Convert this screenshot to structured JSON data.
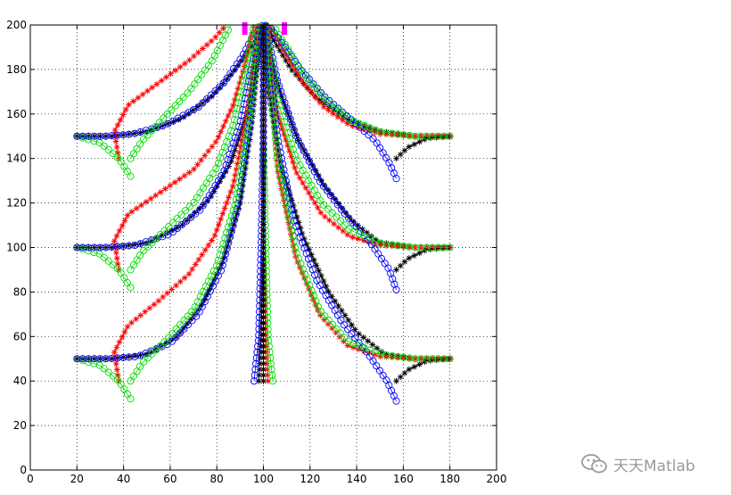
{
  "chart_data": {
    "type": "line",
    "title": "",
    "xlabel": "",
    "ylabel": "",
    "xlim": [
      0,
      200
    ],
    "ylim": [
      0,
      200
    ],
    "xticks": [
      0,
      20,
      40,
      60,
      80,
      100,
      120,
      140,
      160,
      180,
      200
    ],
    "yticks": [
      0,
      20,
      40,
      60,
      80,
      100,
      120,
      140,
      160,
      180,
      200
    ],
    "grid": "dotted",
    "legend": "none",
    "series_colors": {
      "red": "#ff0000",
      "green": "#00dd00",
      "blue": "#0000ff",
      "black": "#000000",
      "magenta": "#ff00ff"
    },
    "series": [
      {
        "color": "black",
        "marker": "star",
        "x": [
          20,
          35,
          50,
          65,
          78,
          88,
          96,
          100
        ],
        "y": [
          150,
          150,
          152,
          158,
          168,
          180,
          192,
          200
        ]
      },
      {
        "color": "red",
        "marker": "star",
        "x": [
          38,
          36,
          42,
          55,
          68,
          79,
          84
        ],
        "y": [
          140,
          152,
          164,
          174,
          184,
          194,
          200
        ]
      },
      {
        "color": "green",
        "marker": "circle",
        "x": [
          43,
          38,
          30,
          20
        ],
        "y": [
          132,
          140,
          147,
          150
        ]
      },
      {
        "color": "blue",
        "marker": "circle",
        "x": [
          20,
          32,
          44,
          58,
          72,
          83,
          91,
          96,
          100
        ],
        "y": [
          150,
          150,
          151,
          155,
          163,
          174,
          186,
          196,
          200
        ]
      },
      {
        "color": "green",
        "marker": "circle",
        "x": [
          43,
          48,
          57,
          68,
          78,
          86
        ],
        "y": [
          140,
          148,
          158,
          170,
          184,
          200
        ]
      },
      {
        "color": "black",
        "marker": "star",
        "x": [
          20,
          35,
          50,
          65,
          77,
          86,
          93,
          98,
          100
        ],
        "y": [
          100,
          100,
          102,
          110,
          122,
          138,
          160,
          185,
          200
        ]
      },
      {
        "color": "red",
        "marker": "star",
        "x": [
          38,
          36,
          42,
          56,
          70,
          80,
          87,
          92,
          96
        ],
        "y": [
          90,
          103,
          115,
          125,
          135,
          148,
          164,
          182,
          200
        ]
      },
      {
        "color": "green",
        "marker": "circle",
        "x": [
          43,
          38,
          30,
          20
        ],
        "y": [
          82,
          90,
          97,
          100
        ]
      },
      {
        "color": "blue",
        "marker": "circle",
        "x": [
          20,
          32,
          45,
          60,
          73,
          83,
          90,
          95,
          99
        ],
        "y": [
          100,
          100,
          101,
          106,
          117,
          134,
          156,
          182,
          200
        ]
      },
      {
        "color": "green",
        "marker": "circle",
        "x": [
          43,
          48,
          58,
          70,
          80,
          87,
          92,
          96
        ],
        "y": [
          90,
          98,
          108,
          120,
          136,
          155,
          177,
          200
        ]
      },
      {
        "color": "black",
        "marker": "star",
        "x": [
          20,
          35,
          50,
          63,
          74,
          83,
          90,
          95,
          99
        ],
        "y": [
          50,
          50,
          52,
          60,
          75,
          95,
          120,
          155,
          200
        ]
      },
      {
        "color": "red",
        "marker": "star",
        "x": [
          38,
          36,
          42,
          55,
          68,
          79,
          87,
          93,
          98
        ],
        "y": [
          40,
          53,
          65,
          76,
          88,
          105,
          128,
          160,
          200
        ]
      },
      {
        "color": "green",
        "marker": "circle",
        "x": [
          43,
          38,
          30,
          20
        ],
        "y": [
          32,
          40,
          47,
          50
        ]
      },
      {
        "color": "blue",
        "marker": "circle",
        "x": [
          20,
          33,
          46,
          60,
          72,
          82,
          89,
          94,
          98
        ],
        "y": [
          50,
          50,
          51,
          57,
          70,
          90,
          118,
          155,
          200
        ]
      },
      {
        "color": "green",
        "marker": "circle",
        "x": [
          43,
          48,
          58,
          70,
          80,
          88,
          94,
          98
        ],
        "y": [
          40,
          48,
          58,
          72,
          92,
          120,
          158,
          200
        ]
      },
      {
        "color": "black",
        "marker": "star",
        "x": [
          180,
          165,
          150,
          135,
          122,
          112,
          105,
          101
        ],
        "y": [
          150,
          150,
          152,
          158,
          168,
          180,
          192,
          200
        ]
      },
      {
        "color": "red",
        "marker": "star",
        "x": [
          180,
          165,
          150,
          137,
          126,
          117,
          109,
          103
        ],
        "y": [
          150,
          150,
          151,
          155,
          163,
          174,
          188,
          200
        ]
      },
      {
        "color": "blue",
        "marker": "circle",
        "x": [
          157,
          154,
          148,
          137,
          126,
          116,
          108,
          102
        ],
        "y": [
          131,
          138,
          148,
          158,
          168,
          180,
          192,
          200
        ]
      },
      {
        "color": "black",
        "marker": "star",
        "x": [
          157,
          162,
          170,
          180
        ],
        "y": [
          140,
          145,
          149,
          150
        ]
      },
      {
        "color": "green",
        "marker": "circle",
        "x": [
          180,
          165,
          150,
          138,
          127,
          117,
          110,
          104
        ],
        "y": [
          150,
          150,
          152,
          157,
          166,
          178,
          190,
          200
        ]
      },
      {
        "color": "black",
        "marker": "star",
        "x": [
          180,
          165,
          150,
          138,
          126,
          115,
          107,
          102,
          100
        ],
        "y": [
          100,
          100,
          102,
          112,
          128,
          148,
          170,
          190,
          200
        ]
      },
      {
        "color": "red",
        "marker": "star",
        "x": [
          180,
          165,
          150,
          137,
          125,
          114,
          106,
          101
        ],
        "y": [
          100,
          100,
          101,
          105,
          115,
          134,
          160,
          200
        ]
      },
      {
        "color": "blue",
        "marker": "circle",
        "x": [
          157,
          154,
          146,
          135,
          124,
          114,
          106,
          101
        ],
        "y": [
          81,
          90,
          102,
          115,
          130,
          150,
          175,
          200
        ]
      },
      {
        "color": "black",
        "marker": "star",
        "x": [
          157,
          162,
          170,
          180
        ],
        "y": [
          90,
          95,
          99,
          100
        ]
      },
      {
        "color": "green",
        "marker": "circle",
        "x": [
          180,
          165,
          150,
          137,
          125,
          114,
          106,
          101
        ],
        "y": [
          100,
          100,
          102,
          108,
          120,
          140,
          166,
          200
        ]
      },
      {
        "color": "black",
        "marker": "star",
        "x": [
          180,
          165,
          152,
          140,
          128,
          117,
          108,
          102,
          100
        ],
        "y": [
          50,
          50,
          52,
          62,
          80,
          105,
          135,
          170,
          200
        ]
      },
      {
        "color": "red",
        "marker": "star",
        "x": [
          180,
          165,
          150,
          136,
          124,
          114,
          106,
          102
        ],
        "y": [
          50,
          50,
          51,
          56,
          70,
          95,
          135,
          200
        ]
      },
      {
        "color": "blue",
        "marker": "circle",
        "x": [
          157,
          153,
          145,
          134,
          123,
          113,
          106,
          101
        ],
        "y": [
          31,
          40,
          52,
          66,
          85,
          112,
          150,
          200
        ]
      },
      {
        "color": "black",
        "marker": "star",
        "x": [
          157,
          162,
          170,
          180
        ],
        "y": [
          40,
          45,
          49,
          50
        ]
      },
      {
        "color": "green",
        "marker": "circle",
        "x": [
          180,
          165,
          150,
          136,
          124,
          114,
          106,
          101
        ],
        "y": [
          50,
          50,
          52,
          58,
          72,
          98,
          140,
          200
        ]
      },
      {
        "color": "red",
        "marker": "star",
        "x": [
          102,
          101,
          100,
          100,
          100
        ],
        "y": [
          40,
          60,
          100,
          150,
          200
        ]
      },
      {
        "color": "black",
        "marker": "star",
        "x": [
          98,
          99,
          100,
          100,
          100
        ],
        "y": [
          40,
          60,
          100,
          150,
          200
        ]
      },
      {
        "color": "green",
        "marker": "circle",
        "x": [
          104,
          102,
          101,
          100,
          100
        ],
        "y": [
          40,
          60,
          100,
          150,
          200
        ]
      },
      {
        "color": "blue",
        "marker": "circle",
        "x": [
          96,
          98,
          99,
          100,
          100
        ],
        "y": [
          40,
          60,
          100,
          150,
          200
        ]
      },
      {
        "color": "red",
        "marker": "star",
        "x": [
          100,
          100,
          100,
          100,
          100
        ],
        "y": [
          40,
          80,
          120,
          160,
          200
        ]
      },
      {
        "color": "black",
        "marker": "star",
        "x": [
          100,
          100,
          100,
          100,
          100
        ],
        "y": [
          40,
          80,
          120,
          160,
          200
        ]
      }
    ],
    "special_markers": [
      {
        "color": "magenta",
        "x": 92,
        "y": 198
      },
      {
        "color": "magenta",
        "x": 109,
        "y": 198
      }
    ]
  },
  "watermark": {
    "text": "天天Matlab",
    "icon": "wechat-icon",
    "color": "#9a9a9a"
  }
}
